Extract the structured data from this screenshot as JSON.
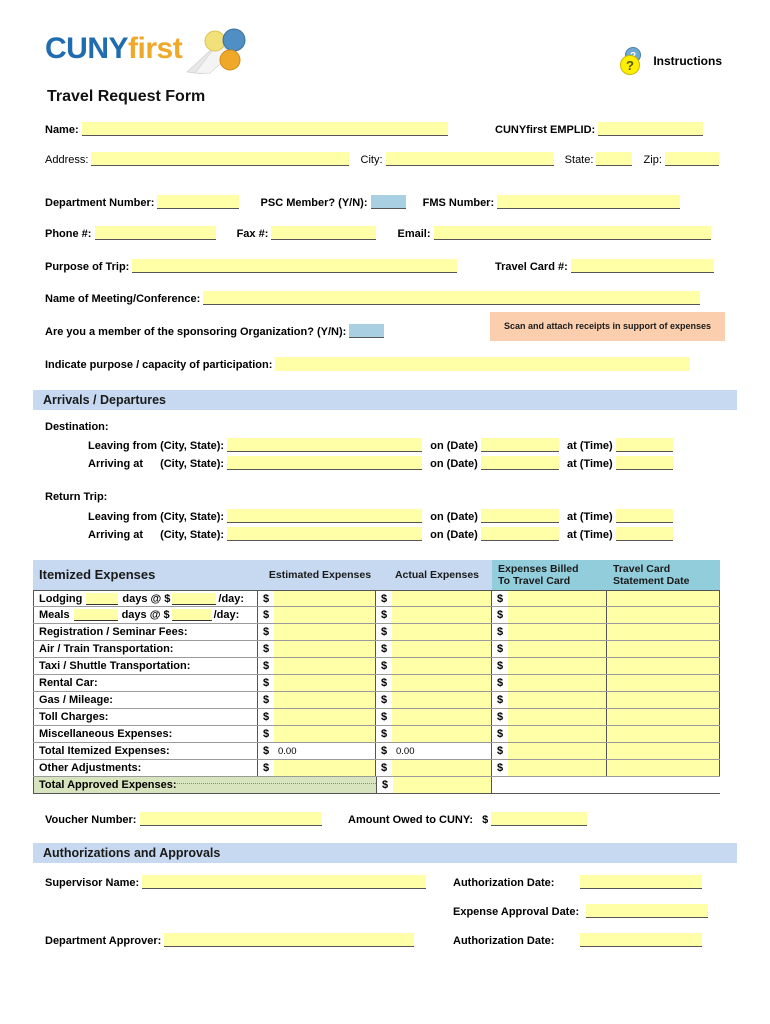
{
  "brand": {
    "cuny": "CUNY",
    "first": "first",
    "logo_icon": "cunyfirst-logo-icon"
  },
  "header": {
    "title": "Travel Request Form",
    "instructions_label": "Instructions",
    "instructions_icon": "question-mark-help-icon"
  },
  "contact": {
    "name_label": "Name:",
    "emplid_label": "CUNYfirst EMPLID:",
    "address_label": "Address:",
    "city_label": "City:",
    "state_label": "State:",
    "zip_label": "Zip:",
    "dept_number_label": "Department Number:",
    "psc_member_label": "PSC Member? (Y/N):",
    "fms_number_label": "FMS Number:",
    "phone_label": "Phone #:",
    "fax_label": "Fax #:",
    "email_label": "Email:",
    "name_value": "",
    "emplid_value": "",
    "address_value": "",
    "city_value": "",
    "state_value": "",
    "zip_value": "",
    "dept_number_value": "",
    "psc_member_value": "",
    "fms_number_value": "",
    "phone_value": "",
    "fax_value": "",
    "email_value": ""
  },
  "trip": {
    "purpose_label": "Purpose of Trip:",
    "travel_card_label": "Travel Card #:",
    "meeting_label": "Name of Meeting/Conference:",
    "member_org_label": "Are you a member of the sponsoring Organization? (Y/N):",
    "capacity_label": "Indicate purpose / capacity of participation:",
    "receipts_note": "Scan and attach receipts in support of expenses",
    "purpose_value": "",
    "travel_card_value": "",
    "meeting_value": "",
    "member_org_value": "",
    "capacity_value": ""
  },
  "arrivals": {
    "section_title": "Arrivals / Departures",
    "destination_label": "Destination:",
    "return_label": "Return Trip:",
    "leaving_label": "Leaving from (City, State):",
    "arriving_label": "Arriving at",
    "arriving_label2": "(City, State):",
    "on_date_label": "on (Date)",
    "at_time_label": "at (Time)",
    "dest_leaving_city": "",
    "dest_leaving_date": "",
    "dest_leaving_time": "",
    "dest_arriving_city": "",
    "dest_arriving_date": "",
    "dest_arriving_time": "",
    "ret_leaving_city": "",
    "ret_leaving_date": "",
    "ret_leaving_time": "",
    "ret_arriving_city": "",
    "ret_arriving_date": "",
    "ret_arriving_time": ""
  },
  "expenses": {
    "title": "Itemized Expenses",
    "col_estimated": "Estimated Expenses",
    "col_actual": "Actual Expenses",
    "col_billed_l1": "Expenses Billed",
    "col_billed_l2": "To Travel Card",
    "col_stmt_l1": "Travel Card",
    "col_stmt_l2": "Statement Date",
    "currency": "$",
    "lodging": {
      "pre": "Lodging",
      "mid": "days @ $",
      "post": "/day:",
      "days": "",
      "rate": ""
    },
    "meals": {
      "pre": "Meals",
      "mid": "days @ $",
      "post": "/day:",
      "days": "",
      "rate": ""
    },
    "rows": [
      {
        "label": "Registration / Seminar Fees:",
        "estimated": "",
        "actual": "",
        "billed": "",
        "stmt": ""
      },
      {
        "label": "Air / Train Transportation:",
        "estimated": "",
        "actual": "",
        "billed": "",
        "stmt": ""
      },
      {
        "label": "Taxi / Shuttle Transportation:",
        "estimated": "",
        "actual": "",
        "billed": "",
        "stmt": ""
      },
      {
        "label": "Rental Car:",
        "estimated": "",
        "actual": "",
        "billed": "",
        "stmt": ""
      },
      {
        "label": "Gas / Mileage:",
        "estimated": "",
        "actual": "",
        "billed": "",
        "stmt": ""
      },
      {
        "label": "Toll Charges:",
        "estimated": "",
        "actual": "",
        "billed": "",
        "stmt": ""
      },
      {
        "label": "Miscellaneous Expenses:",
        "estimated": "",
        "actual": "",
        "billed": "",
        "stmt": ""
      }
    ],
    "lodging_estimated": "",
    "lodging_actual": "",
    "lodging_billed": "",
    "lodging_stmt": "",
    "meals_estimated": "",
    "meals_actual": "",
    "meals_billed": "",
    "meals_stmt": "",
    "total_itemized_label": "Total Itemized Expenses:",
    "total_itemized_estimated": "0.00",
    "total_itemized_actual": "0.00",
    "total_itemized_billed": "",
    "total_itemized_stmt": "",
    "other_adj_label": "Other Adjustments:",
    "other_adj_estimated": "",
    "other_adj_actual": "",
    "other_adj_billed": "",
    "other_adj_stmt": "",
    "total_approved_label": "Total Approved Expenses:",
    "total_approved_value": "",
    "voucher_label": "Voucher Number:",
    "voucher_value": "",
    "amount_owed_label": "Amount Owed to CUNY:",
    "amount_owed_value": ""
  },
  "auth": {
    "section_title": "Authorizations and Approvals",
    "supervisor_label": "Supervisor Name:",
    "supervisor_value": "",
    "auth_date_label": "Authorization Date:",
    "auth_date_value": "",
    "expense_approval_label": "Expense Approval Date:",
    "expense_approval_value": "",
    "dept_approver_label": "Department Approver:",
    "dept_approver_value": "",
    "auth_date2_label": "Authorization Date:",
    "auth_date2_value": ""
  },
  "colors": {
    "field_yellow": "#ffffa8",
    "field_blue": "#a8cfe2",
    "section_bar": "#c6d9f1",
    "table_header_teal": "#92cddc",
    "note_peach": "#fbcfae",
    "total_green": "#d7e4bd",
    "brand_blue": "#1f6cb0",
    "brand_orange": "#f0a828"
  }
}
